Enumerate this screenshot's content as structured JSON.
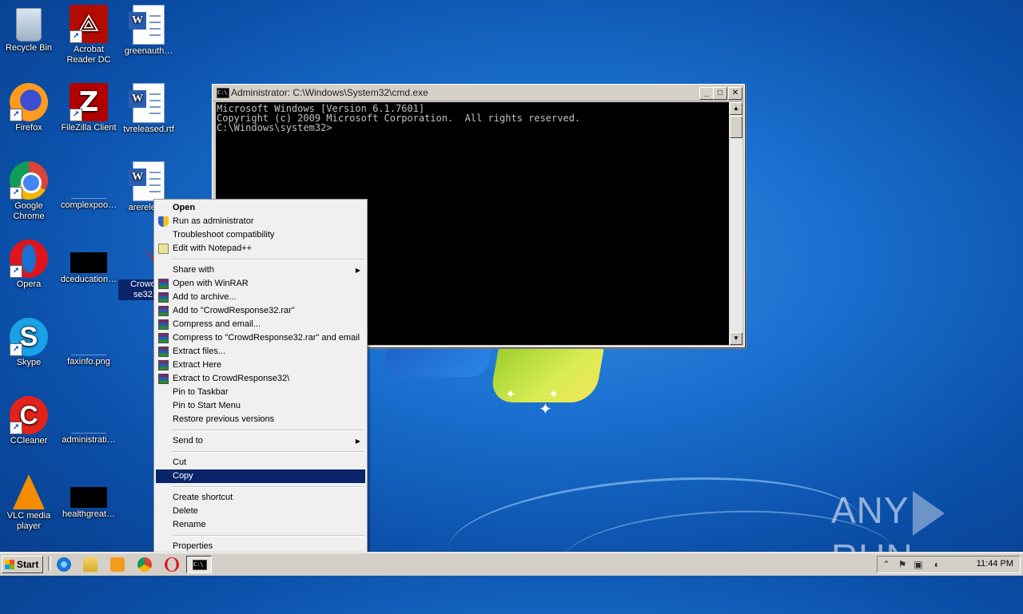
{
  "desktop": {
    "icons": [
      {
        "label": "Recycle Bin"
      },
      {
        "label": "Acrobat Reader DC"
      },
      {
        "label": "greenauth…"
      },
      {
        "label": "Firefox"
      },
      {
        "label": "FileZilla Client"
      },
      {
        "label": "tvreleased.rtf"
      },
      {
        "label": "Google Chrome"
      },
      {
        "label": "complexpoo…"
      },
      {
        "label": "arerelev…"
      },
      {
        "label": "Opera"
      },
      {
        "label": "dceducation…"
      },
      {
        "label": "CrowdRe se32.…"
      },
      {
        "label": "Skype"
      },
      {
        "label": "faxinfo.png"
      },
      {
        "label": "CCleaner"
      },
      {
        "label": "administrati…"
      },
      {
        "label": "VLC media player"
      },
      {
        "label": "healthgreat…"
      }
    ]
  },
  "cmd_window": {
    "title": "Administrator: C:\\Windows\\System32\\cmd.exe",
    "icon": "cmd-icon",
    "lines": [
      "Microsoft Windows [Version 6.1.7601]",
      "Copyright (c) 2009 Microsoft Corporation.  All rights reserved.",
      "",
      "C:\\Windows\\system32>"
    ],
    "buttons": {
      "minimize": "_",
      "maximize": "□",
      "close": "✕"
    }
  },
  "context_menu": {
    "items": [
      {
        "label": "Open",
        "bold": true
      },
      {
        "label": "Run as administrator",
        "icon": "uac-shield-icon"
      },
      {
        "label": "Troubleshoot compatibility"
      },
      {
        "label": "Edit with Notepad++",
        "icon": "notepadpp-icon"
      },
      {
        "label": "Share with",
        "submenu": true
      },
      {
        "label": "Open with WinRAR",
        "icon": "winrar-icon"
      },
      {
        "label": "Add to archive...",
        "icon": "winrar-icon"
      },
      {
        "label": "Add to \"CrowdResponse32.rar\"",
        "icon": "winrar-icon"
      },
      {
        "label": "Compress and email...",
        "icon": "winrar-icon"
      },
      {
        "label": "Compress to \"CrowdResponse32.rar\" and email",
        "icon": "winrar-icon"
      },
      {
        "label": "Extract files...",
        "icon": "winrar-icon"
      },
      {
        "label": "Extract Here",
        "icon": "winrar-icon"
      },
      {
        "label": "Extract to CrowdResponse32\\",
        "icon": "winrar-icon"
      },
      {
        "label": "Pin to Taskbar"
      },
      {
        "label": "Pin to Start Menu"
      },
      {
        "label": "Restore previous versions"
      },
      {
        "label": "Send to",
        "submenu": true
      },
      {
        "label": "Cut"
      },
      {
        "label": "Copy",
        "highlighted": true
      },
      {
        "label": "Create shortcut"
      },
      {
        "label": "Delete"
      },
      {
        "label": "Rename"
      },
      {
        "label": "Properties"
      }
    ],
    "arrow": "▶"
  },
  "taskbar": {
    "start_label": "Start",
    "quick_launch": [
      "ie-icon",
      "explorer-icon",
      "media-player-icon",
      "chrome-icon",
      "opera-icon"
    ],
    "active_task_icon": "cmd-icon",
    "tray_icons": [
      "show-hidden-icons-icon",
      "action-center-flag-icon",
      "network-icon",
      "volume-icon"
    ],
    "clock": "11:44 PM"
  },
  "watermark": {
    "left": "ANY",
    "right": "RUN"
  },
  "colors": {
    "highlight": "#0a246a",
    "menu_bg": "#f0f0f0",
    "desktop": "#1a6fcf"
  }
}
